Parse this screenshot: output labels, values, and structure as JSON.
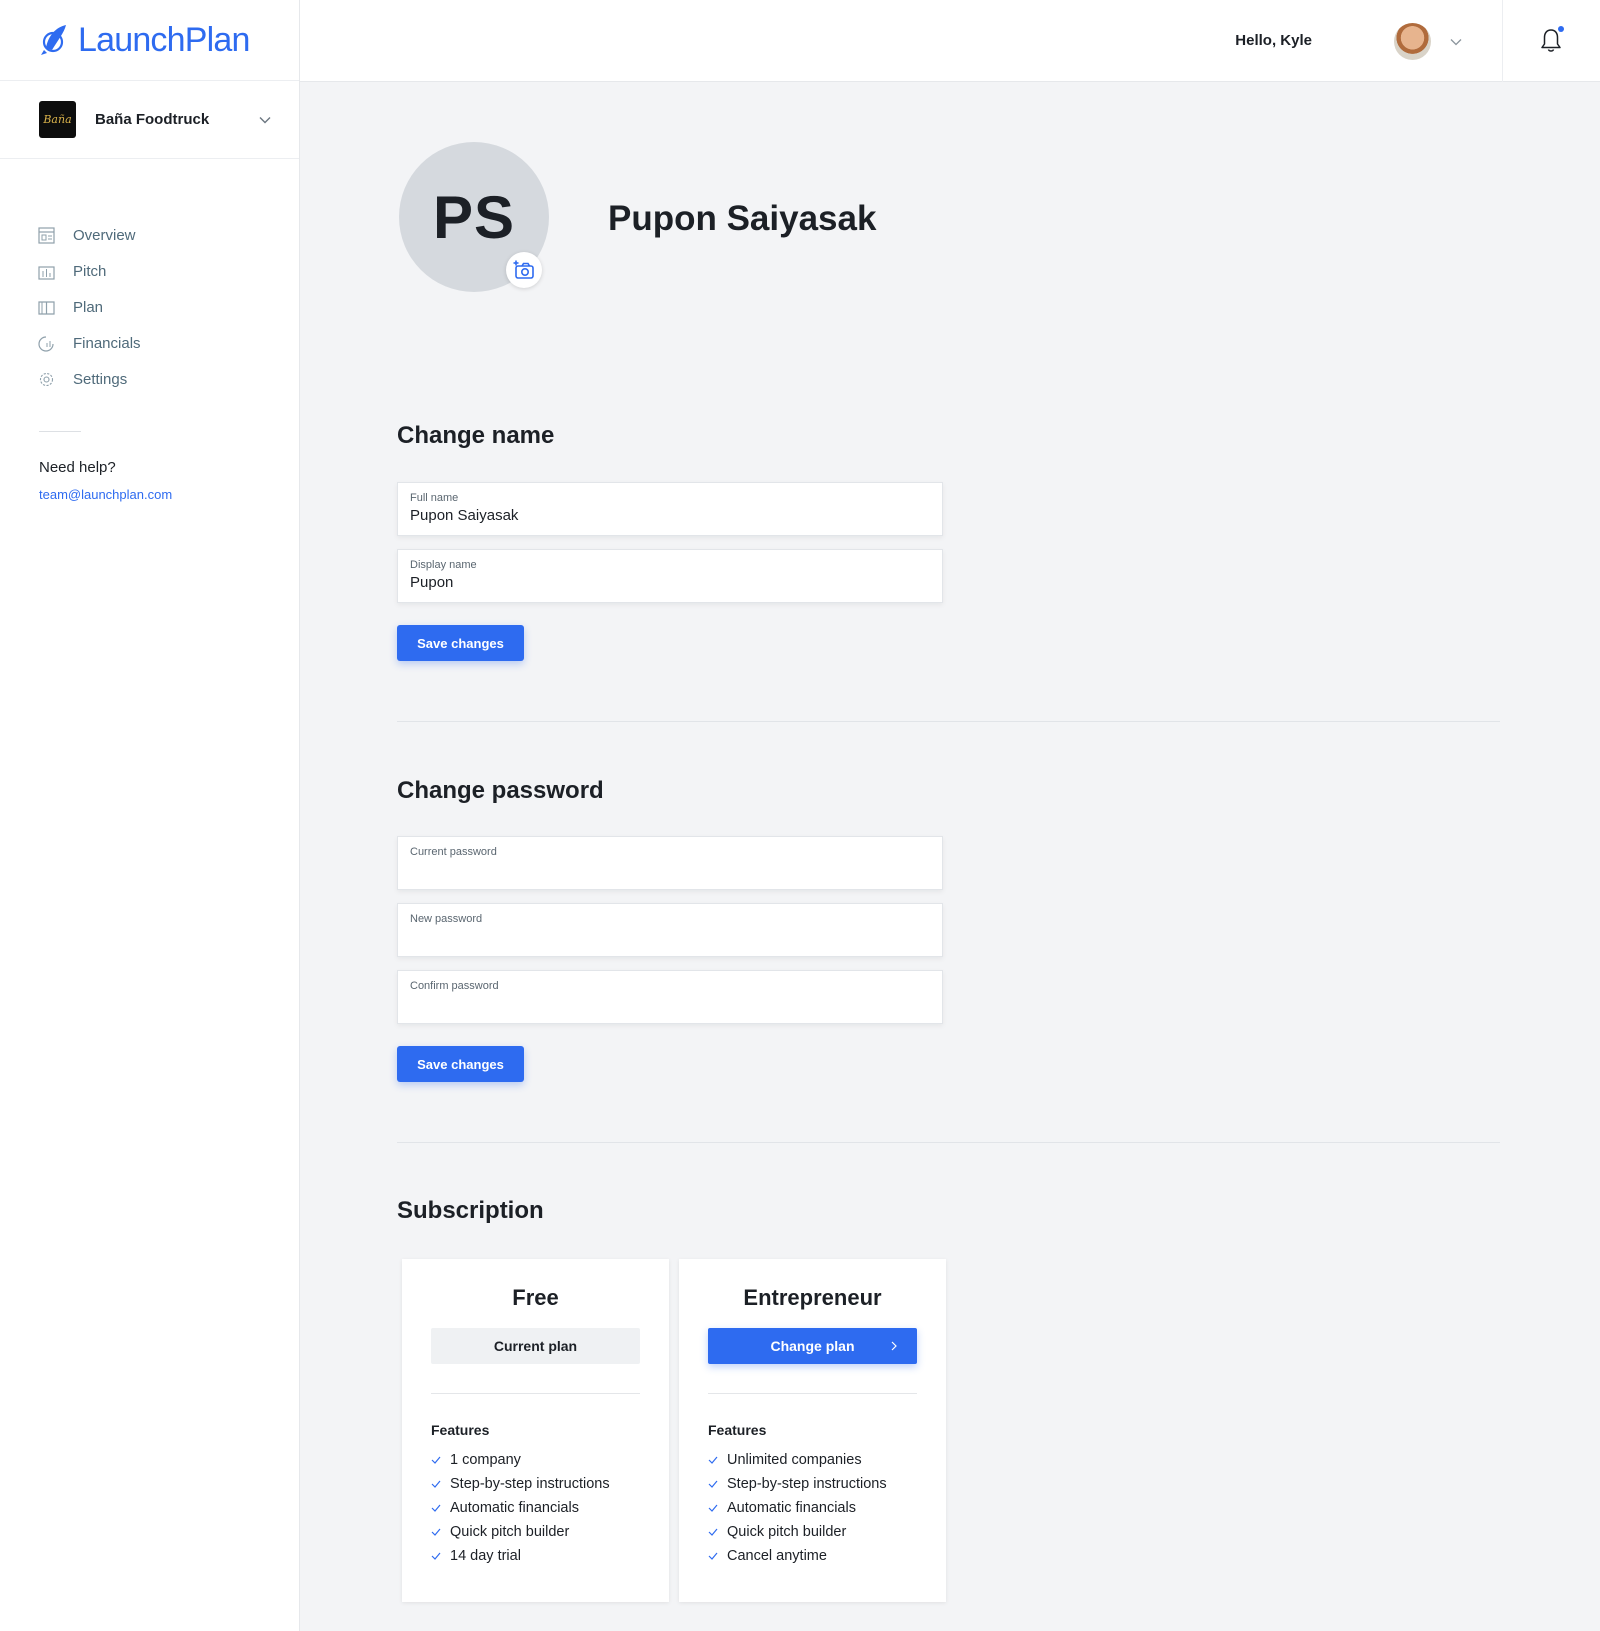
{
  "app": {
    "name": "LaunchPlan"
  },
  "company": {
    "name": "Baña Foodtruck",
    "logo_text": "Baña"
  },
  "sidebar": {
    "items": [
      {
        "label": "Overview",
        "icon": "overview-icon"
      },
      {
        "label": "Pitch",
        "icon": "pitch-icon"
      },
      {
        "label": "Plan",
        "icon": "plan-icon"
      },
      {
        "label": "Financials",
        "icon": "financials-icon"
      },
      {
        "label": "Settings",
        "icon": "settings-icon"
      }
    ],
    "help_title": "Need help?",
    "help_email": "team@launchplan.com"
  },
  "header": {
    "greeting": "Hello, Kyle"
  },
  "profile": {
    "initials": "PS",
    "name": "Pupon Saiyasak"
  },
  "change_name": {
    "title": "Change name",
    "full_name_label": "Full name",
    "full_name_value": "Pupon Saiyasak",
    "display_name_label": "Display name",
    "display_name_value": "Pupon",
    "save_label": "Save changes"
  },
  "change_password": {
    "title": "Change password",
    "current_label": "Current password",
    "new_label": "New password",
    "confirm_label": "Confirm password",
    "save_label": "Save changes"
  },
  "subscription": {
    "title": "Subscription",
    "plans": [
      {
        "name": "Free",
        "action": "Current plan",
        "features_title": "Features",
        "features": [
          "1 company",
          "Step-by-step instructions",
          "Automatic financials",
          "Quick pitch builder",
          "14 day trial"
        ]
      },
      {
        "name": "Entrepreneur",
        "action": "Change plan",
        "features_title": "Features",
        "features": [
          "Unlimited companies",
          "Step-by-step instructions",
          "Automatic financials",
          "Quick pitch builder",
          "Cancel anytime"
        ]
      }
    ]
  },
  "colors": {
    "accent": "#2e6bf0",
    "background": "#f3f4f6",
    "nav_text": "#4f6a7a"
  }
}
